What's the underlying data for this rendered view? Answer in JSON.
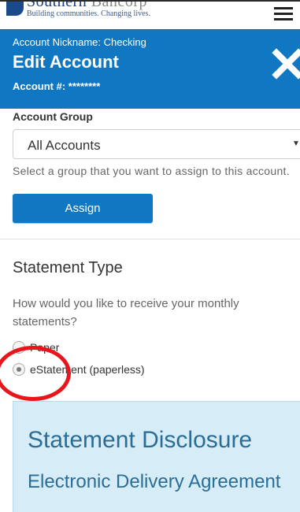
{
  "brand": {
    "name_main": "Southern",
    "name_soft": "Bancorp",
    "tagline": "Building communities. Changing lives."
  },
  "header": {
    "nickname": "Account Nickname: Checking",
    "title": "Edit Account",
    "account_number": "Account #: ********",
    "bg_color": "#1078c2"
  },
  "account_group": {
    "label": "Account Group",
    "selected": "All Accounts",
    "help": "Select a group that you want to assign to this account."
  },
  "assign_label": "Assign",
  "statement": {
    "title": "Statement Type",
    "question": "How would you like to receive your monthly statements?",
    "options": [
      {
        "label": "Paper",
        "checked": false
      },
      {
        "label": "eStatement (paperless)",
        "checked": true
      }
    ]
  },
  "disclosure": {
    "title": "Statement Disclosure",
    "subtitle": "Electronic Delivery Agreement"
  },
  "icons": {
    "menu": "hamburger-icon",
    "close": "close-icon",
    "caret": "caret-down-icon"
  },
  "colors": {
    "accent": "#1078c2",
    "annotation": "#e8161c",
    "disclosure_bg": "#d6ecf7",
    "disclosure_text": "#2a6d96"
  }
}
